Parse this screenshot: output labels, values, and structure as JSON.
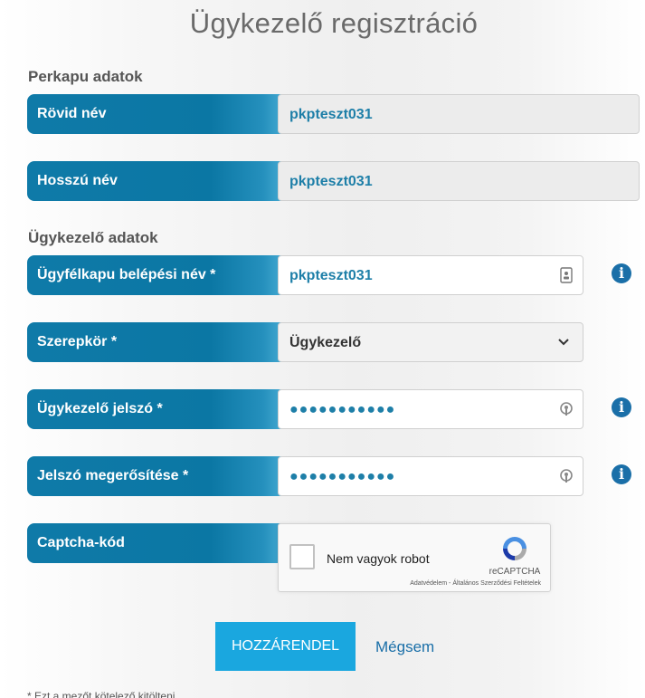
{
  "page_title": "Ügykezelő regisztráció",
  "sections": {
    "perkapu": "Perkapu adatok",
    "ugykezelo": "Ügykezelő adatok"
  },
  "fields": {
    "rovid_nev": {
      "label": "Rövid név",
      "value": "pkpteszt031"
    },
    "hosszu_nev": {
      "label": "Hosszú név",
      "value": "pkpteszt031"
    },
    "ugyfelkapu": {
      "label": "Ügyfélkapu belépési név *",
      "value": "pkpteszt031"
    },
    "szerepkor": {
      "label": "Szerepkör *",
      "value": "Ügykezelő"
    },
    "jelszo": {
      "label": "Ügykezelő jelszó *",
      "value": "●●●●●●●●●●●"
    },
    "jelszo_megerosites": {
      "label": "Jelszó megerősítése *",
      "value": "●●●●●●●●●●●"
    },
    "captcha": {
      "label": "Captcha-kód"
    }
  },
  "captcha_widget": {
    "checkbox_label": "Nem vagyok robot",
    "brand": "reCAPTCHA",
    "links": "Adatvédelem - Általános Szerződési Feltételek"
  },
  "actions": {
    "submit": "HOZZÁRENDEL",
    "cancel": "Mégsem"
  },
  "info_icon_glyph": "i",
  "footnote": "* Ezt a mezőt kötelező kitölteni",
  "colors": {
    "label_bg": "#0b77a4",
    "value_text": "#1e7fa8",
    "info_icon": "#1a6fa8",
    "submit_bg": "#1aa7df"
  }
}
